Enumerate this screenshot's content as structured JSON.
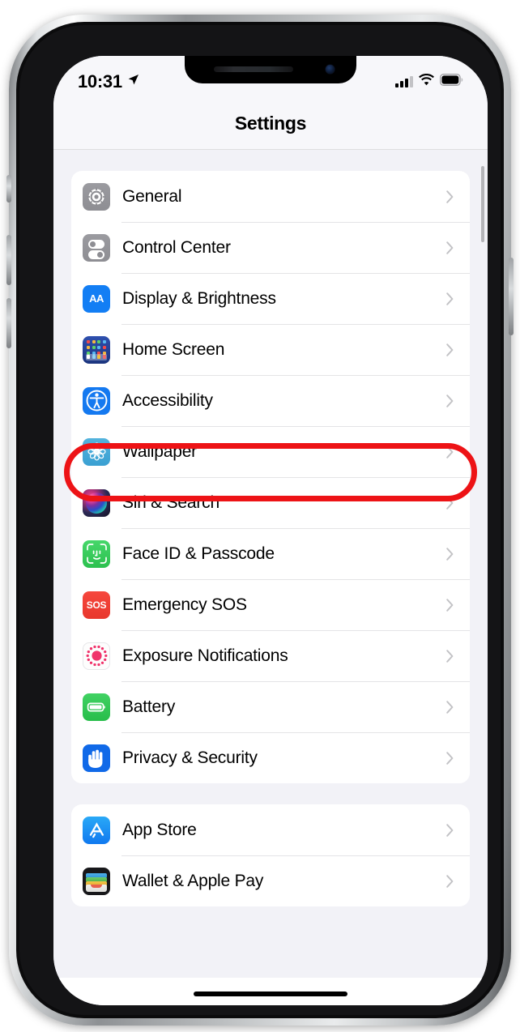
{
  "status_bar": {
    "time": "10:31",
    "location_icon": "location-arrow-icon",
    "signal_icon": "cellular-signal-icon",
    "signal_bars_filled": 3,
    "signal_bars_total": 4,
    "wifi_icon": "wifi-icon",
    "battery_icon": "battery-full-icon"
  },
  "nav": {
    "title": "Settings"
  },
  "annotation": {
    "type": "red-oval-highlight",
    "target_row": "Accessibility",
    "color": "#ed1316"
  },
  "theme": {
    "background": "#f2f2f7",
    "card": "#ffffff",
    "separator": "#e4e4e6",
    "label": "#000000",
    "chevron": "#c2c2c5"
  },
  "groups": [
    {
      "id": "group-system",
      "rows": [
        {
          "label": "General",
          "icon": "gear-icon",
          "icon_class": "ic-general"
        },
        {
          "label": "Control Center",
          "icon": "control-center-icon",
          "icon_class": "ic-control"
        },
        {
          "label": "Display & Brightness",
          "icon": "display-brightness-icon",
          "icon_class": "ic-display",
          "glyph": "AA"
        },
        {
          "label": "Home Screen",
          "icon": "home-screen-icon",
          "icon_class": "ic-home"
        },
        {
          "label": "Accessibility",
          "icon": "accessibility-icon",
          "icon_class": "ic-access",
          "highlighted": true
        },
        {
          "label": "Wallpaper",
          "icon": "wallpaper-flower-icon",
          "icon_class": "ic-wallpaper"
        },
        {
          "label": "Siri & Search",
          "icon": "siri-orb-icon",
          "icon_class": "ic-siri"
        },
        {
          "label": "Face ID & Passcode",
          "icon": "face-id-icon",
          "icon_class": "ic-faceid"
        },
        {
          "label": "Emergency SOS",
          "icon": "emergency-sos-icon",
          "icon_class": "ic-sos",
          "glyph": "SOS"
        },
        {
          "label": "Exposure Notifications",
          "icon": "exposure-notifications-icon",
          "icon_class": "ic-exposure"
        },
        {
          "label": "Battery",
          "icon": "battery-icon",
          "icon_class": "ic-battery"
        },
        {
          "label": "Privacy & Security",
          "icon": "privacy-hand-icon",
          "icon_class": "ic-privacy"
        }
      ]
    },
    {
      "id": "group-store",
      "rows": [
        {
          "label": "App Store",
          "icon": "app-store-icon",
          "icon_class": "ic-appstore"
        },
        {
          "label": "Wallet & Apple Pay",
          "icon": "wallet-icon",
          "icon_class": "ic-wallet"
        }
      ]
    }
  ]
}
